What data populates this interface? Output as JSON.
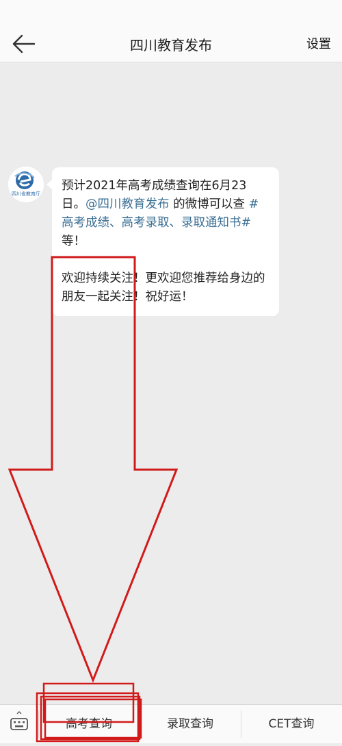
{
  "header": {
    "title": "四川教育发布",
    "settings_label": "设置",
    "back_icon": "arrow-left-icon"
  },
  "message": {
    "avatar_text": "四川省教育厅",
    "para1_text1": "预计2021年高考成绩查询在6月23日。",
    "mention": "@四川教育发布",
    "para1_text2": " 的微博可以查 ",
    "hashtag": "#高考成绩、高考录取、录取通知书#",
    "para1_text3": "等！",
    "para2": "欢迎持续关注！更欢迎您推荐给身边的朋友一起关注！祝好运！"
  },
  "footer": {
    "keyboard_icon": "keyboard-icon",
    "tabs": [
      {
        "label": "高考查询"
      },
      {
        "label": "录取查询"
      },
      {
        "label": "CET查询"
      }
    ]
  },
  "colors": {
    "link": "#3b6f94",
    "annotation": "#d11a1a"
  }
}
